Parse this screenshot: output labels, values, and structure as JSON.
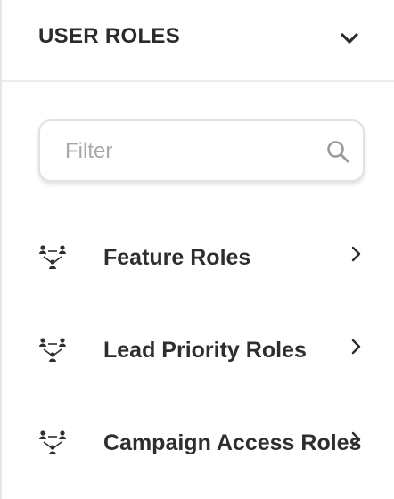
{
  "header": {
    "title": "USER ROLES",
    "toggle_icon": "chevron-down-icon"
  },
  "filter": {
    "placeholder": "Filter",
    "value": "",
    "icon": "search-icon"
  },
  "roles": [
    {
      "label": "Feature Roles",
      "icon": "role-hierarchy-icon"
    },
    {
      "label": "Lead Priority Roles",
      "icon": "role-hierarchy-icon"
    },
    {
      "label": "Campaign Access Roles",
      "icon": "role-hierarchy-icon"
    }
  ],
  "colors": {
    "text": "#2b2b2b",
    "placeholder": "#a8a8a8",
    "border": "#e2e2e2",
    "icon": "#2f2f2f"
  }
}
